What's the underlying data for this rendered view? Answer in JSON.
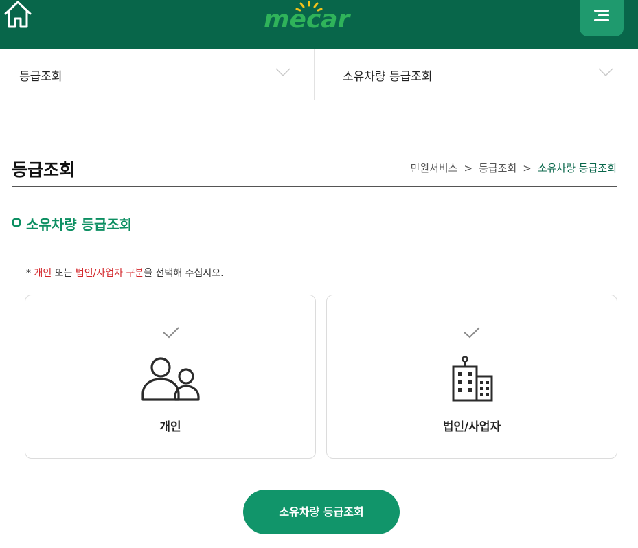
{
  "header": {
    "logo_text": "mecar",
    "home_icon": "home-icon",
    "menu_icon": "hamburger-menu-icon"
  },
  "selectors": {
    "left": {
      "label": "등급조회",
      "icon": "chevron-down-icon"
    },
    "right": {
      "label": "소유차량 등급조회",
      "icon": "chevron-down-icon"
    }
  },
  "page": {
    "title": "등급조회",
    "breadcrumb": [
      "민원서비스",
      "등급조회",
      "소유차량 등급조회"
    ],
    "breadcrumb_separator": ">"
  },
  "section": {
    "heading": "소유차량 등급조회"
  },
  "notice": {
    "prefix": "* ",
    "opt1": "개인",
    "mid": " 또는 ",
    "opt2": "법인/사업자 구분",
    "suffix": "을 선택해 주십시오."
  },
  "options": [
    {
      "label": "개인",
      "icon": "people-icon",
      "check_icon": "check-icon"
    },
    {
      "label": "법인/사업자",
      "icon": "building-icon",
      "check_icon": "check-icon"
    }
  ],
  "submit_button": {
    "label": "소유차량 등급조회"
  },
  "colors": {
    "header_bg": "#08664a",
    "menu_button_bg": "#1f9a6e",
    "accent_green": "#0d8f62",
    "button_green": "#11956a",
    "highlight_red": "#d3272b"
  }
}
